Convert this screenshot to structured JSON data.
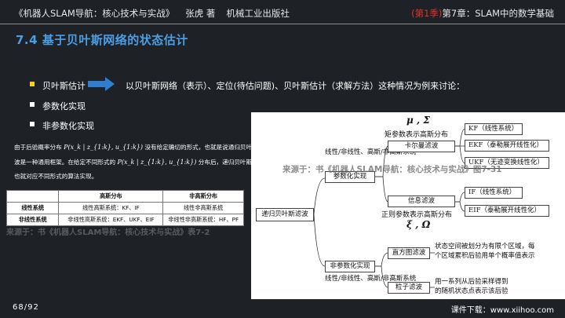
{
  "header": {
    "book": "《机器人SLAM导航：核心技术与实战》",
    "author": "张虎 著",
    "publisher": "机械工业出版社",
    "season": "(第1季)",
    "chapter": "第7章：SLAM中的数学基础"
  },
  "title": "7.4 基于贝叶斯网络的状态估计",
  "bullets": {
    "b1": "贝叶斯估计",
    "b1_desc": "以贝叶斯网络（表示）、定位(待估问题)、贝叶斯估计（求解方法）这种情况为例来讨论：",
    "b2": "参数化实现",
    "b3": "非参数化实现"
  },
  "paragraph": {
    "l1a": "由于后验概率分布",
    "l1f": "P(x_k | z_{1:k}, u_{1:k})",
    "l1b": "没有给定确切的形式，也就是说通归贝叶斯滤",
    "l2a": "波是一种通用框架。在给定不同形式的",
    "l2f": "P(x_k | z_{1:k}, u_{1:k})",
    "l2b": "分布后，递归贝叶斯滤波",
    "l3": "也就对应不同形式的算法实现。"
  },
  "table": {
    "headers": [
      "",
      "高斯分布",
      "非高斯分布"
    ],
    "rows": [
      [
        "线性系统",
        "线性高斯系统：KF、IF",
        "线性非高斯系统"
      ],
      [
        "非线性系统",
        "非线性高斯系统：EKF、UKF、EIF",
        "非线性非高斯系统：HF、PF"
      ]
    ]
  },
  "watermark_table": "来源于：书《机器人SLAM导航：核心技术与实战》表7-2",
  "diagram": {
    "root": "递归贝叶斯滤波",
    "param": "参数化实现",
    "param_cond": "线性/非线性、高斯/非高斯系统",
    "mu_sigma": "μ , Σ",
    "moment": "矩参数表示高斯分布",
    "kalman": "卡尔曼滤波",
    "kf": "KF（线性系统）",
    "ekf": "EKF（泰勒展开线性化）",
    "ukf": "UKF（无迹变换线性化）",
    "info": "信息滤波",
    "canon": "正则参数表示高斯分布",
    "xi_omega": "ξ , Ω",
    "if_": "IF（线性系统）",
    "eif": "EIF（泰勒展开线性化）",
    "nonparam": "非参数化实现",
    "nonparam_cond": "线性/非线性、高斯/非高斯系统",
    "hist": "直方图滤波",
    "hist_desc1": "状态空间被划分为有限个区域，每",
    "hist_desc2": "个区域累积后验用单个概率值表示",
    "particle": "粒子滤波",
    "part_desc1": "用一系列从后验采样得到",
    "part_desc2": "的随机状态点表示该后验"
  },
  "watermark_diagram": "来源于：书《机器人SLAM导航：核心技术与实战》图7-31",
  "footer": {
    "page": "68/92",
    "site": "课件下载：www.xiihoo.com"
  },
  "colors": {
    "accent": "#4a9fe6",
    "bullet": "#f3d21c",
    "season": "#e0332b",
    "bg": "#1e2126"
  }
}
